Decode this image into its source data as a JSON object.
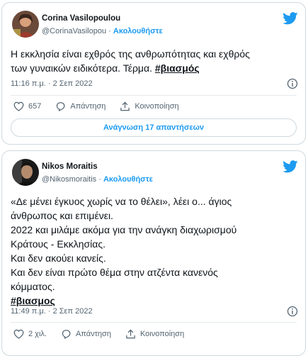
{
  "tweets": [
    {
      "name": "Corina Vasilopoulou",
      "handle": "@CorinaVasilopou",
      "separator": "·",
      "follow_label": "Ακολουθήστε",
      "text_lines": [
        "Η εκκλησία είναι εχθρός της ανθρωπότητας και εχθρός",
        "των γυναικών ειδικότερα. Τέρμα. "
      ],
      "hashtag": "#βιασμός",
      "timestamp": "11:16 π.μ. · 2 Σεπ 2022",
      "likes": "657",
      "reply_label": "Απάντηση",
      "share_label": "Κοινοποίηση",
      "read_replies_label": "Ανάγνωση 17 απαντήσεων"
    },
    {
      "name": "Nikos Moraitis",
      "handle": "@Nikosmoraitis",
      "separator": "·",
      "follow_label": "Ακολουθήστε",
      "text_lines": [
        "«Δε μένει έγκυος χωρίς να το θέλει», λέει ο... άγιος",
        "άνθρωπος και επιμένει.",
        "2022 και μιλάμε ακόμα για την ανάγκη διαχωρισμού",
        "Κράτους - Εκκλησίας.",
        "Και δεν ακούει κανείς.",
        "Και δεν είναι πρώτο θέμα στην ατζέντα κανενός",
        "κόμματος."
      ],
      "hashtag": "#βιασμος",
      "timestamp": "11:49 π.μ. · 2 Σεπ 2022",
      "likes": "2 χιλ.",
      "reply_label": "Απάντηση",
      "share_label": "Κοινοποίηση"
    }
  ],
  "colors": {
    "accent": "#1d9bf0",
    "text": "#0f1419",
    "muted": "#536471",
    "border": "#cfd9de"
  },
  "icons": [
    "twitter-bird-icon",
    "info-icon",
    "heart-icon",
    "reply-bubble-icon",
    "share-icon"
  ]
}
